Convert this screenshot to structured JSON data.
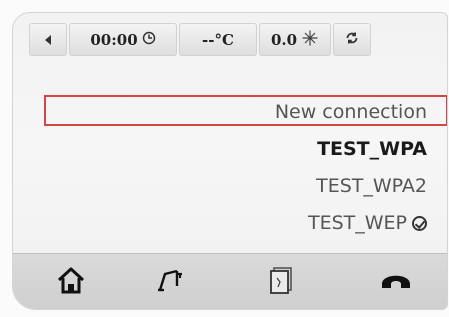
{
  "status_bar": {
    "back_icon": "back-triangle-icon",
    "time": "00:00",
    "time_icon": "clock-icon",
    "temperature": "--°C",
    "fan_value": "0.0",
    "fan_icon": "fan-icon",
    "sync_icon": "sync-icon"
  },
  "connections": {
    "new_label": "New connection",
    "items": [
      {
        "label": "TEST_WPA"
      },
      {
        "label": "TEST_WPA2"
      },
      {
        "label": "TEST_WEP"
      }
    ]
  },
  "nav": {
    "home_icon": "home-icon",
    "scale_icon": "scale-icon",
    "document_icon": "document-icon",
    "connection_icon": "connection-icon"
  },
  "colors": {
    "highlight": "#d64545"
  }
}
